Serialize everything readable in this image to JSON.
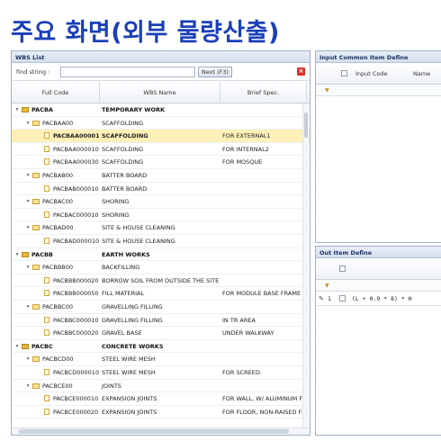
{
  "page_title": "주요 화면(외부 물량산출)",
  "wbs_panel": {
    "title": "WBS List",
    "find_label": "find string :",
    "find_value": "",
    "find_button": "Next (F3)",
    "close_icon": "close-icon",
    "columns": [
      "Full Code",
      "WBS Name",
      "Brief Spec."
    ],
    "rows": [
      {
        "level": 0,
        "kind": "group",
        "expander": "-",
        "code": "PACBA",
        "name": "TEMPORARY WORK",
        "spec": ""
      },
      {
        "level": 1,
        "kind": "folder",
        "expander": "-",
        "code": "PACBAA00",
        "name": "SCAFFOLDING",
        "spec": ""
      },
      {
        "level": 2,
        "kind": "item",
        "expander": "",
        "code": "PACBAA000010",
        "name": "SCAFFOLDING",
        "spec": "FOR EXTERNAL1",
        "selected": true
      },
      {
        "level": 2,
        "kind": "item",
        "expander": "",
        "code": "PACBAA000010",
        "name": "SCAFFOLDING",
        "spec": "FOR INTERNAL2"
      },
      {
        "level": 2,
        "kind": "item",
        "expander": "",
        "code": "PACBAA000030",
        "name": "SCAFFOLDING",
        "spec": "FOR MOSQUE"
      },
      {
        "level": 1,
        "kind": "folder",
        "expander": "-",
        "code": "PACBAB00",
        "name": "BATTER BOARD",
        "spec": ""
      },
      {
        "level": 2,
        "kind": "item",
        "expander": "",
        "code": "PACBAB000010",
        "name": "BATTER BOARD",
        "spec": ""
      },
      {
        "level": 1,
        "kind": "folder",
        "expander": "-",
        "code": "PACBAC00",
        "name": "SHORING",
        "spec": ""
      },
      {
        "level": 2,
        "kind": "item",
        "expander": "",
        "code": "PACBAC000010",
        "name": "SHORING",
        "spec": ""
      },
      {
        "level": 1,
        "kind": "folder",
        "expander": "-",
        "code": "PACBAD00",
        "name": "SITE & HOUSE CLEANING",
        "spec": ""
      },
      {
        "level": 2,
        "kind": "item",
        "expander": "",
        "code": "PACBAD000010",
        "name": "SITE & HOUSE CLEANING",
        "spec": ""
      },
      {
        "level": 0,
        "kind": "group",
        "expander": "-",
        "code": "PACBB",
        "name": "EARTH WORKS",
        "spec": ""
      },
      {
        "level": 1,
        "kind": "folder",
        "expander": "-",
        "code": "PACBBB00",
        "name": "BACKFILLING",
        "spec": ""
      },
      {
        "level": 2,
        "kind": "item",
        "expander": "",
        "code": "PACBBB000020",
        "name": "BORROW SOIL FROM OUTSIDE THE SITE",
        "spec": ""
      },
      {
        "level": 2,
        "kind": "item",
        "expander": "",
        "code": "PACBBB000050",
        "name": "FILL MATERIAL",
        "spec": "FOR MODULE BASE FRAME"
      },
      {
        "level": 1,
        "kind": "folder",
        "expander": "-",
        "code": "PACBBC00",
        "name": "GRAVELLING FILLING",
        "spec": ""
      },
      {
        "level": 2,
        "kind": "item",
        "expander": "",
        "code": "PACBBC000010",
        "name": "GRAVELLING FILLING",
        "spec": "IN TR AREA"
      },
      {
        "level": 2,
        "kind": "item",
        "expander": "",
        "code": "PACBBC000020",
        "name": "GRAVEL BASE",
        "spec": "UNDER WALKWAY"
      },
      {
        "level": 0,
        "kind": "group",
        "expander": "-",
        "code": "PACBC",
        "name": "CONCRETE WORKS",
        "spec": ""
      },
      {
        "level": 1,
        "kind": "folder",
        "expander": "-",
        "code": "PACBCD00",
        "name": "STEEL WIRE MESH",
        "spec": ""
      },
      {
        "level": 2,
        "kind": "item",
        "expander": "",
        "code": "PACBCD000010",
        "name": "STEEL WIRE MESH",
        "spec": "FOR SCREED."
      },
      {
        "level": 1,
        "kind": "folder",
        "expander": "-",
        "code": "PACBCE00",
        "name": "JOINTS",
        "spec": ""
      },
      {
        "level": 2,
        "kind": "item",
        "expander": "",
        "code": "PACBCE000010",
        "name": "EXPANSION JOINTS",
        "spec": "FOR WALL, W/ ALUMINUM FLASH"
      },
      {
        "level": 2,
        "kind": "item",
        "expander": "",
        "code": "PACBCE000020",
        "name": "EXPANSION JOINTS",
        "spec": "FOR FLOOR, NON-RAISED FLOOR"
      }
    ]
  },
  "input_panel": {
    "title": "Input Common Item Define",
    "columns": [
      "Input Code",
      "Name"
    ],
    "filter_icon": "filter-icon"
  },
  "out_panel": {
    "title": "Out Item Define",
    "filter_icon": "filter-icon",
    "rows": [
      {
        "icon": "pencil-icon",
        "num": "1",
        "formula": "(L + 0.9 * 8) * H"
      }
    ]
  },
  "colors": {
    "title": "#1a3fb8",
    "selected_row": "#fff0b8",
    "close_button": "#d9302b"
  }
}
